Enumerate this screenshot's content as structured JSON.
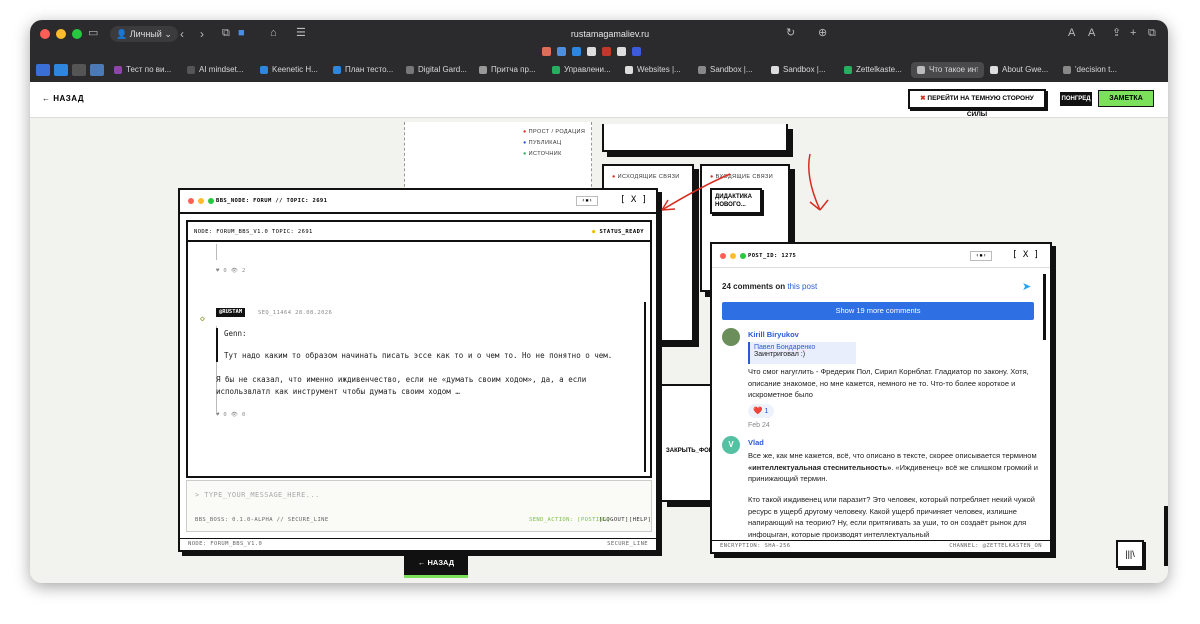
{
  "browser": {
    "profile": "Личный",
    "url": "rustamagamaliev.ru",
    "tabs": [
      {
        "label": "Тест по ви...",
        "color": "#8e44ad"
      },
      {
        "label": "AI mindset...",
        "color": "#555555"
      },
      {
        "label": "Keenetic H...",
        "color": "#2e86de"
      },
      {
        "label": "План тесто...",
        "color": "#2e86de"
      },
      {
        "label": "Digital Gard...",
        "color": "#777777"
      },
      {
        "label": "Притча пр...",
        "color": "#999999"
      },
      {
        "label": "Управлени...",
        "color": "#27ae60"
      },
      {
        "label": "Websites |...",
        "color": "#dddddd"
      },
      {
        "label": "Sandbox |...",
        "color": "#888888"
      },
      {
        "label": "Sandbox |...",
        "color": "#dddddd"
      },
      {
        "label": "Zettelkaste...",
        "color": "#27ae60"
      },
      {
        "label": "Что такое интеллек...",
        "color": "#bbbbbb"
      },
      {
        "label": "About Gwe...",
        "color": "#dddddd"
      },
      {
        "label": "'decision t...",
        "color": "#888888"
      }
    ],
    "font_size_small": "A",
    "font_size_large": "A"
  },
  "header": {
    "back_label": "← НАЗАД",
    "dark_side_label": "ПЕРЕЙТИ НА ТЕМНУЮ СТОРОНУ СИЛЫ",
    "upgrade_label": "ПОНГРЕД",
    "note_label": "ЗАМЕТКА"
  },
  "background": {
    "legend": [
      "ПРОСТ / РОДАЦИЯ",
      "ПУБЛИКАЦ",
      "ИСТОЧНИК"
    ],
    "outgoing_label": "ИСХОДЯЩИЕ СВЯЗИ",
    "incoming_label": "ВХОДЯЩИЕ СВЯЗИ",
    "incoming_item": "ДИДАКТИКА НОВОГО...",
    "close_form_label": "ЗАКРЫТЬ_ФОР",
    "back_label": "← НАЗАД"
  },
  "forum": {
    "title": "BBS_NODE: FORUM // TOPIC: 2691",
    "close_label": "[ X ]",
    "subheader_left": "NODE: FORUM_BBS_V1.0   TOPIC: 2691",
    "status": "STATUS_READY",
    "prev_post_stats": "♥ 0   👁 2",
    "author": "@RUSTAM",
    "post_meta": "SEQ_11464   28.08.2026",
    "quote_author": "Genn:",
    "quote_text": "Тут надо каким то образом начинать писать эссе как то и о чем то. Но не понятно о чем.",
    "reply_text": "Я бы не сказал, что именно иждивенчество, если не «думать своим ходом», да, а если использвлатл как инструмент чтобы думать своим ходом …",
    "post_stats": "♥ 0   👁 0",
    "input_placeholder": "> TYPE_YOUR_MESSAGE_HERE...",
    "footer_left": "BBS_BOSS: 0.1.0-ALPHA // SECURE_LINE",
    "footer_send": "SEND_ACTION: [POSTING]",
    "footer_logout": "[LOGOUT]",
    "footer_help": "[HELP]",
    "status_left": "NODE: FORUM_BBS_V1.0",
    "status_right": "SECURE_LINE"
  },
  "comments": {
    "title": "POST_ID: 1275",
    "close_label": "[ X ]",
    "count_text": "24 comments on",
    "count_link": "this post",
    "show_more": "Show 19 more comments",
    "items": [
      {
        "author": "Kirill Biryukov",
        "reply_to": "Павел Бондаренко",
        "reply_quote": "Заинтриговал :)",
        "text": "Что смог нагуглить - Фредерик Пол, Сирил Корнблат. Гладиатор по закону. Хотя, описание знакомое, но мне кажется, немного не то. Что-то более короткое и искрометное было",
        "reaction": "❤️ 1",
        "date": "Feb 24"
      },
      {
        "author": "Vlad",
        "avatar_letter": "V",
        "text_1": "Все же, как мне кажется, всё, что описано в тексте, скорее описывается термином",
        "text_bold": "«интеллектуальная стеснительность»",
        "text_2": ". «Иждивенец» всё же слишком громкий и принижающий термин.",
        "text_para2": "Кто такой иждивенец или паразит? Это человек, который потребляет некий чужой ресурс в ущерб другому человеку. Какой ущерб причиняет человек, излишне напирающий на теорию? Ну, если притягивать за уши, то он создаёт рынок для инфоцыган, которые производят интеллектуальный"
      }
    ],
    "status_left": "ENCRYPTION: SHA-256",
    "status_right": "CHANNEL: @ZETTELKASTEN_ON"
  },
  "colors": {
    "accent_green": "#7be05a",
    "link_blue": "#2a5bd7",
    "show_more_blue": "#2f6fe4",
    "annotation_red": "#d62d20"
  }
}
